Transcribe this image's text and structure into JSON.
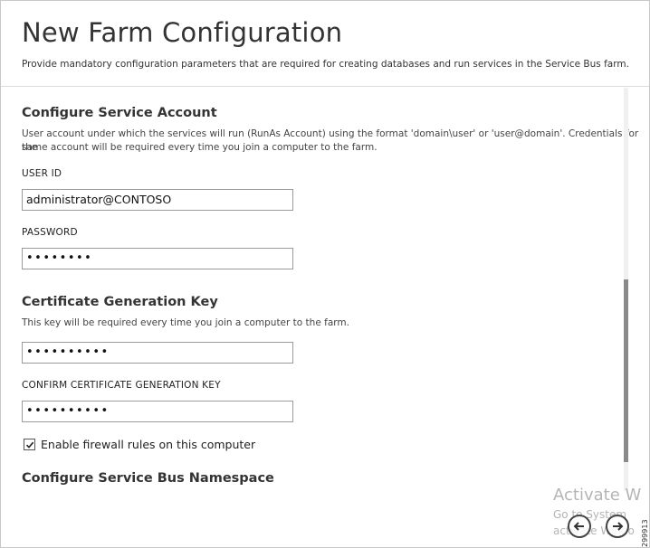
{
  "page": {
    "title": "New Farm Configuration",
    "subtitle": "Provide mandatory configuration parameters that are required for creating databases and run services in the Service Bus farm."
  },
  "service_account": {
    "heading": "Configure Service Account",
    "description_line1": "User account under which the services will run (RunAs Account) using the format 'domain\\user' or 'user@domain'. Credentials for the",
    "description_line2": "same account will be required every time you join a computer to the farm.",
    "user_id_label": "USER ID",
    "user_id_value": "administrator@CONTOSO",
    "password_label": "PASSWORD",
    "password_value": "••••••••"
  },
  "certificate": {
    "heading": "Certificate Generation Key",
    "description": "This key will be required every time you join a computer to the farm.",
    "key_value": "••••••••••",
    "confirm_label": "CONFIRM CERTIFICATE GENERATION KEY",
    "confirm_value": "••••••••••"
  },
  "firewall": {
    "label": "Enable firewall rules on this computer",
    "checked": true
  },
  "namespace": {
    "heading": "Configure Service Bus Namespace"
  },
  "watermark": {
    "title": "Activate W",
    "subtitle": "Go to System",
    "subtitle2": "activate Windo"
  },
  "figure_id": "299913",
  "icons": {
    "back": "arrow-left-circle-icon",
    "next": "arrow-right-circle-icon",
    "check": "checkmark-icon"
  }
}
